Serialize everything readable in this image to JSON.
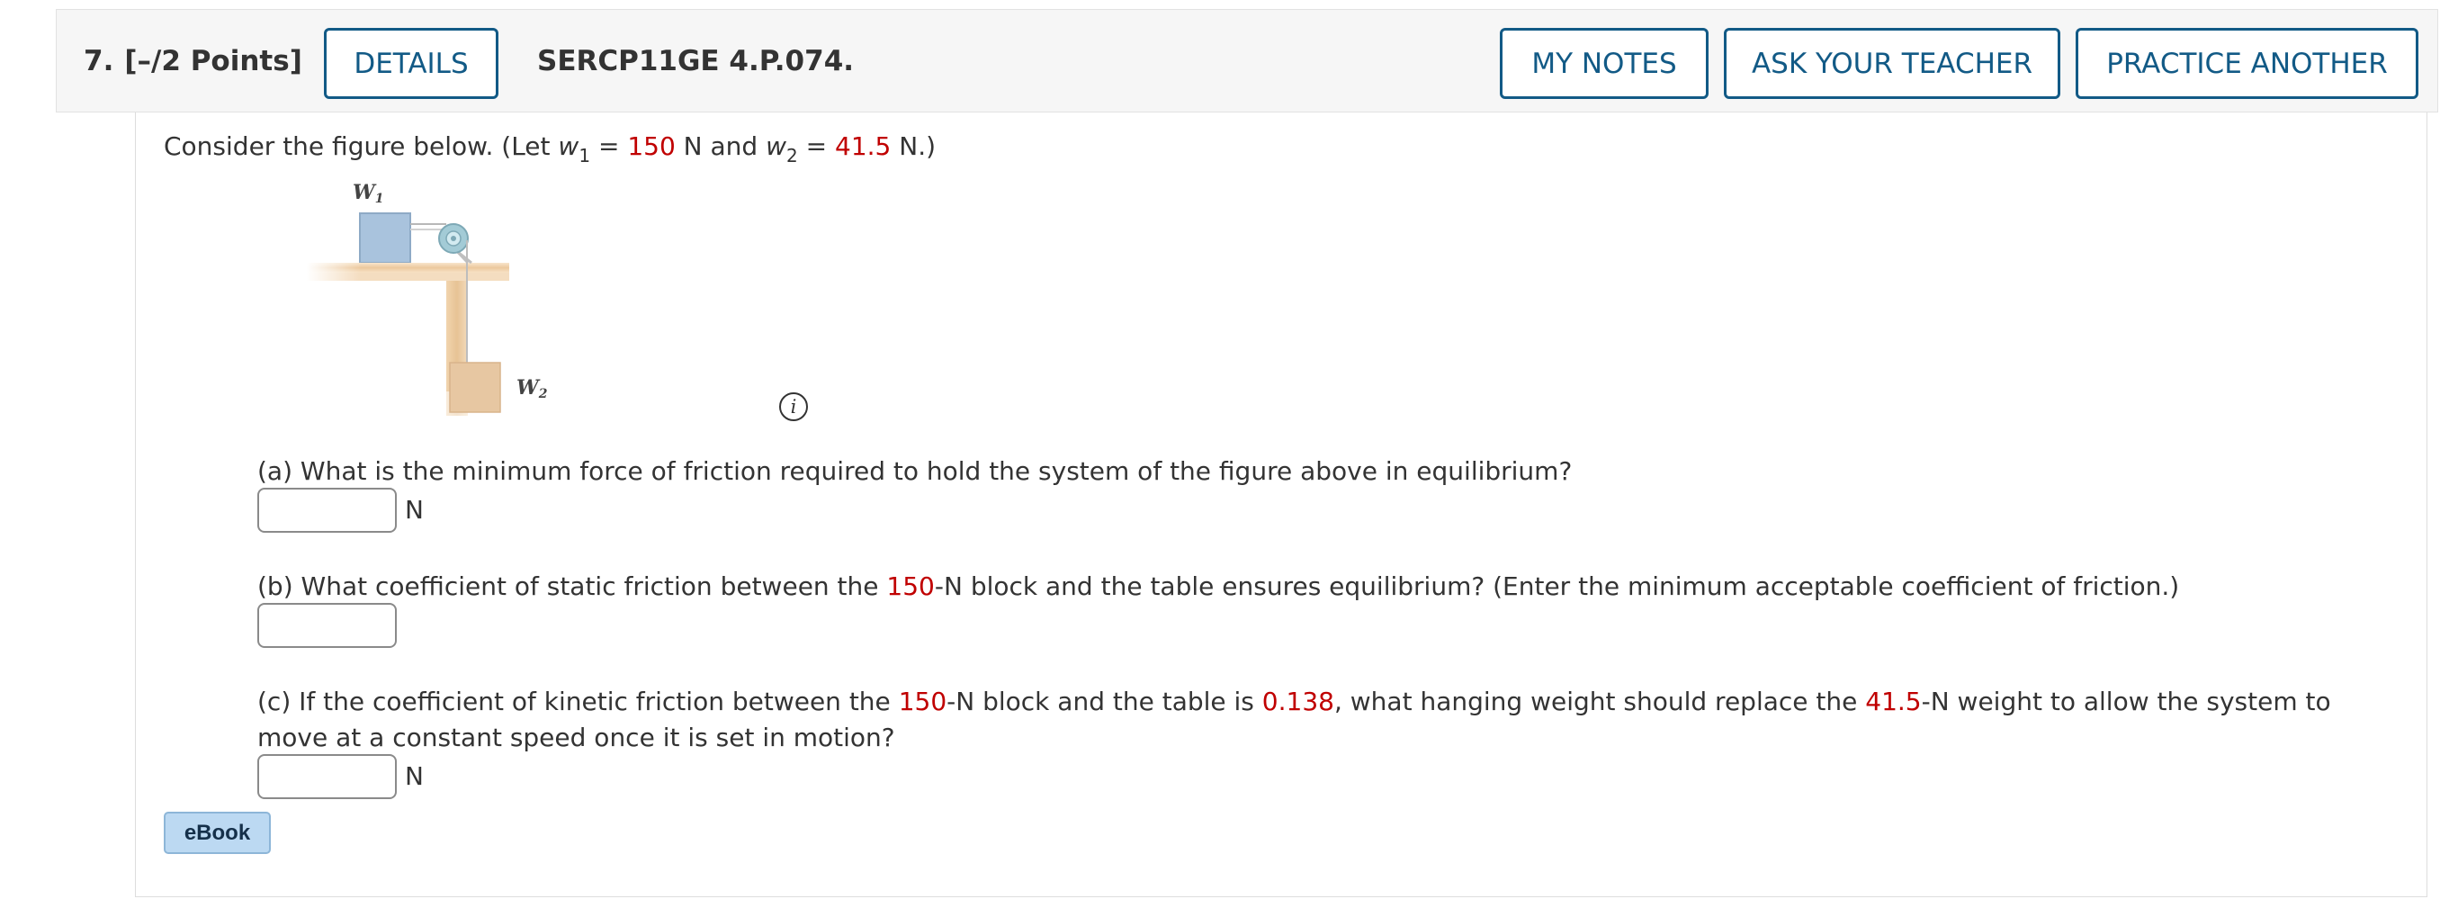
{
  "header": {
    "question_number": "7.",
    "points": "[–/2 Points]",
    "details_label": "DETAILS",
    "question_code": "SERCP11GE 4.P.074.",
    "my_notes_label": "MY NOTES",
    "ask_teacher_label": "ASK YOUR TEACHER",
    "practice_another_label": "PRACTICE ANOTHER"
  },
  "intro": {
    "prefix": "Consider the figure below. (Let ",
    "w_symbol": "w",
    "w1_sub": "1",
    "equals": " = ",
    "w1_value": "150",
    "w1_unit_and": " N and ",
    "w2_sub": "2",
    "w2_value": "41.5",
    "suffix": " N.)"
  },
  "figure": {
    "w1_label": "W",
    "w1_sub": "1",
    "w2_label": "W",
    "w2_sub": "2",
    "colors": {
      "block_w1": "#a9c3dd",
      "block_w2": "#e7c7a2",
      "table": "#efd3ae",
      "pulley": "#a3cbd6"
    }
  },
  "info_icon": {
    "glyph": "i"
  },
  "questions": {
    "a": {
      "text": "(a) What is the minimum force of friction required to hold the system of the figure above in equilibrium?",
      "unit": "N",
      "value": ""
    },
    "b": {
      "text_1": "(b) What coefficient of static friction between the ",
      "value_1": "150",
      "text_2": "-N block and the table ensures equilibrium? (Enter the minimum acceptable coefficient of friction.)",
      "value": ""
    },
    "c": {
      "text_1": "(c) If the coefficient of kinetic friction between the ",
      "value_1": "150",
      "text_2": "-N block and the table is ",
      "value_2": "0.138",
      "text_3": ", what hanging weight should replace the ",
      "value_3": "41.5",
      "text_4": "-N weight to allow the system to move at a constant speed once it is set in motion?",
      "unit": "N",
      "value": ""
    }
  },
  "ebook_label": "eBook",
  "colors": {
    "accent": "#125a86",
    "highlight": "#c00000"
  }
}
